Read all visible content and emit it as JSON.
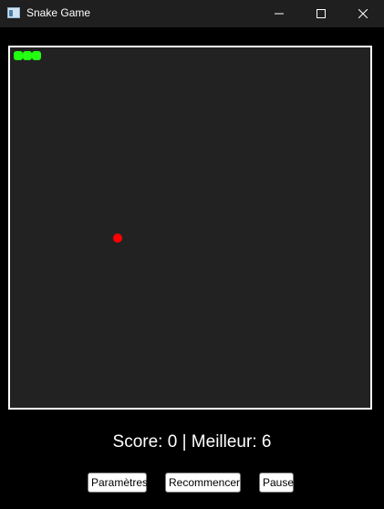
{
  "window": {
    "title": "Snake Game",
    "controls": [
      "minimize-icon",
      "maximize-icon",
      "close-icon"
    ]
  },
  "game": {
    "snake_color": "#22ff11",
    "food_color": "#ff0000",
    "board_color": "#222222",
    "border_color": "#ffffff",
    "snake_length": 3
  },
  "status": {
    "score_label": "Score:",
    "score": "0",
    "separator": "|",
    "best_label": "Meilleur:",
    "best": "6"
  },
  "buttons": {
    "settings": "Paramètres",
    "restart": "Recommencer",
    "pause": "Pause"
  }
}
